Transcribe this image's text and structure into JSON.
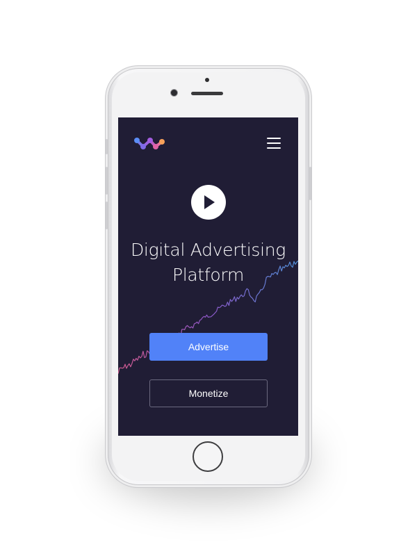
{
  "app": {
    "headline_line1": "Digital Advertising",
    "headline_line2": "Platform"
  },
  "buttons": {
    "advertise_label": "Advertise",
    "monetize_label": "Monetize"
  },
  "icons": {
    "logo": "brand-logo-dots",
    "menu": "hamburger-menu-icon",
    "play": "play-icon"
  },
  "colors": {
    "screen_background": "#201d35",
    "primary_button": "#5182f8",
    "secondary_button_border": "#6c6a80",
    "logo_blue": "#5b8df6",
    "logo_purple": "#a35de0",
    "logo_pink": "#e063a6",
    "logo_orange": "#f7a15a",
    "trend_start": "#d05a8e",
    "trend_mid": "#8e57c9",
    "trend_end": "#4f8fd6"
  }
}
